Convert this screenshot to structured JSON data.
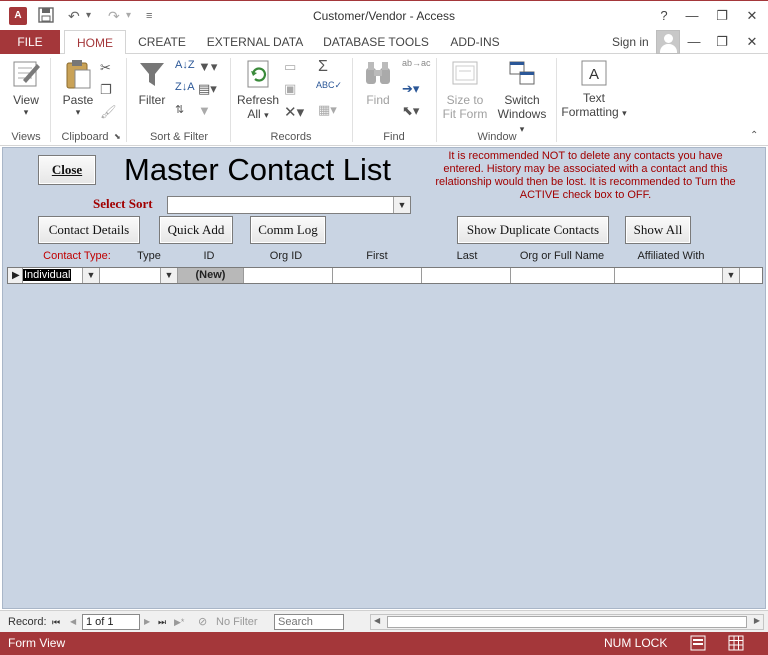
{
  "window": {
    "title": "Customer/Vendor - Access",
    "app_icon": "A⃣",
    "help": "?",
    "minimize": "—",
    "restore": "❐",
    "close": "✕",
    "ribbon_min": "—",
    "ribbon_restore": "❐",
    "ribbon_close": "✕"
  },
  "quick_access": {
    "save": "💾",
    "undo": "↶",
    "undo_drop": "▾",
    "redo": "↷",
    "redo_drop": "▾",
    "customize": "≡"
  },
  "tabs": {
    "file": "FILE",
    "home": "HOME",
    "create": "CREATE",
    "external": "EXTERNAL DATA",
    "dbtools": "DATABASE TOOLS",
    "addins": "ADD-INS",
    "signin": "Sign in"
  },
  "ribbon": {
    "view": "View",
    "paste": "Paste",
    "filter": "Filter",
    "refresh_line1": "Refresh",
    "refresh_line2": "All",
    "find": "Find",
    "size_line1": "Size to",
    "size_line2": "Fit Form",
    "switch_line1": "Switch",
    "switch_line2": "Windows",
    "text_line1": "Text",
    "text_line2": "Formatting",
    "drop": "▾",
    "group_views": "Views",
    "group_clipboard": "Clipboard",
    "group_sortfilter": "Sort & Filter",
    "group_records": "Records",
    "group_find": "Find",
    "group_window": "Window"
  },
  "form": {
    "close_btn": "Close",
    "title": "Master Contact List",
    "warning": "It is recommended NOT to delete any contacts you have entered.  History may be associated with a contact and this relationship would then be lost.  It is recommended to Turn the ACTIVE check box to OFF.",
    "sort_label": "Select Sort",
    "sort_value": "",
    "buttons": {
      "contact_details": "Contact Details",
      "quick_add": "Quick Add",
      "comm_log": "Comm Log",
      "show_duplicates": "Show Duplicate Contacts",
      "show_all": "Show All"
    },
    "columns": {
      "contact_type": "Contact Type:",
      "type": "Type",
      "id": "ID",
      "org_id": "Org ID",
      "first": "First",
      "last": "Last",
      "org_name": "Org or Full Name",
      "affiliated": "Affiliated With"
    },
    "row": {
      "contact_type": "Individual",
      "type": "",
      "id": "(New)",
      "org_id": "",
      "first": "",
      "last": "",
      "org_name": "",
      "affiliated": ""
    }
  },
  "navigator": {
    "record_label": "Record:",
    "first": "⏮",
    "prev": "◀",
    "position": "1 of 1",
    "next": "▶",
    "last": "⏭",
    "new": "▶*",
    "filter_status": "No Filter",
    "search_placeholder": "Search",
    "scroll_left": "◀",
    "scroll_right": "▶"
  },
  "status": {
    "mode": "Form View",
    "numlock": "NUM LOCK"
  },
  "colors": {
    "accent": "#a4373a",
    "form_bg": "#c9d4e3",
    "warning_text": "#a10000"
  }
}
